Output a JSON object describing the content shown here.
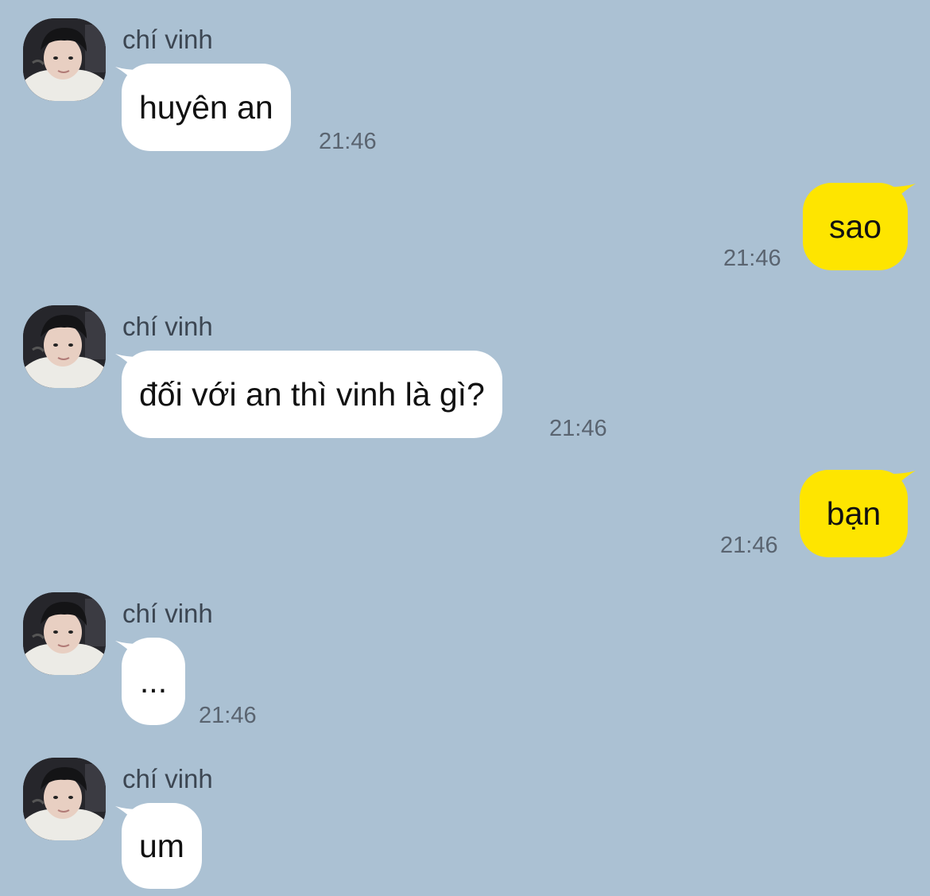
{
  "contact": {
    "name": "chí vinh"
  },
  "colors": {
    "background": "#abc1d3",
    "incoming_bubble": "#ffffff",
    "outgoing_bubble": "#fee500",
    "sender_text": "#3c4652",
    "timestamp_text": "#5a6470"
  },
  "messages": [
    {
      "direction": "incoming",
      "sender": "chí vinh",
      "text": "huyên an",
      "time": "21:46"
    },
    {
      "direction": "outgoing",
      "text": "sao",
      "time": "21:46"
    },
    {
      "direction": "incoming",
      "sender": "chí vinh",
      "text": "đối với an thì vinh là gì?",
      "time": "21:46"
    },
    {
      "direction": "outgoing",
      "text": "bạn",
      "time": "21:46"
    },
    {
      "direction": "incoming",
      "sender": "chí vinh",
      "text": "...",
      "time": "21:46"
    },
    {
      "direction": "incoming",
      "sender": "chí vinh",
      "text": "um"
    }
  ]
}
